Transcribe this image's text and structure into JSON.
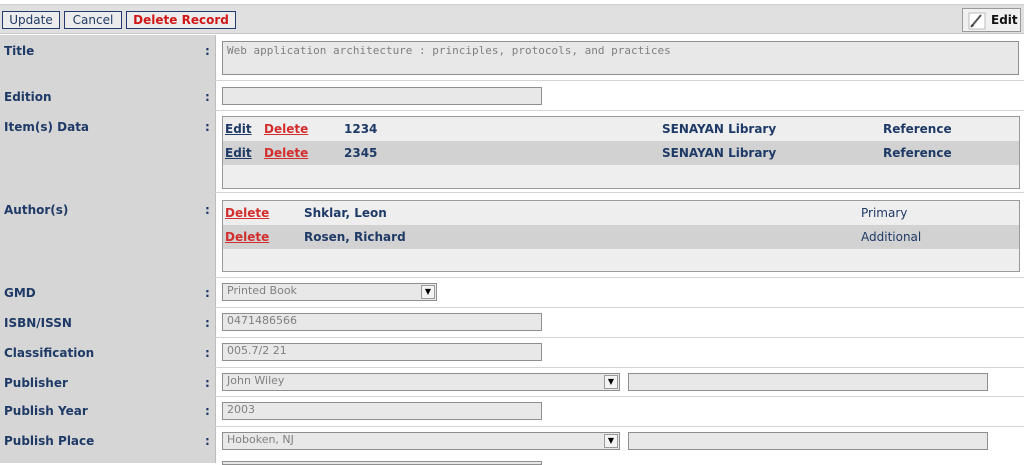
{
  "toolbar": {
    "update_label": "Update",
    "cancel_label": "Cancel",
    "delete_label": "Delete Record",
    "edit_label": "Edit"
  },
  "colon": ":",
  "fields": {
    "title": {
      "label": "Title",
      "value": "Web application architecture : principles, protocols, and practices"
    },
    "edition": {
      "label": "Edition",
      "value": ""
    },
    "items": {
      "label": "Item(s) Data",
      "rows": [
        {
          "edit": "Edit",
          "delete": "Delete",
          "code": "1234",
          "location": "SENAYAN Library",
          "type": "Reference"
        },
        {
          "edit": "Edit",
          "delete": "Delete",
          "code": "2345",
          "location": "SENAYAN Library",
          "type": "Reference"
        }
      ]
    },
    "authors": {
      "label": "Author(s)",
      "rows": [
        {
          "delete": "Delete",
          "name": "Shklar, Leon",
          "role": "Primary"
        },
        {
          "delete": "Delete",
          "name": "Rosen, Richard",
          "role": "Additional"
        }
      ]
    },
    "gmd": {
      "label": "GMD",
      "value": "Printed Book"
    },
    "isbn": {
      "label": "ISBN/ISSN",
      "value": "0471486566"
    },
    "classification": {
      "label": "Classification",
      "value": "005.7/2 21"
    },
    "publisher": {
      "label": "Publisher",
      "value": "John Wiley",
      "extra": ""
    },
    "publish_year": {
      "label": "Publish Year",
      "value": "2003"
    },
    "publish_place": {
      "label": "Publish Place",
      "value": "Hoboken, NJ",
      "extra": ""
    }
  }
}
